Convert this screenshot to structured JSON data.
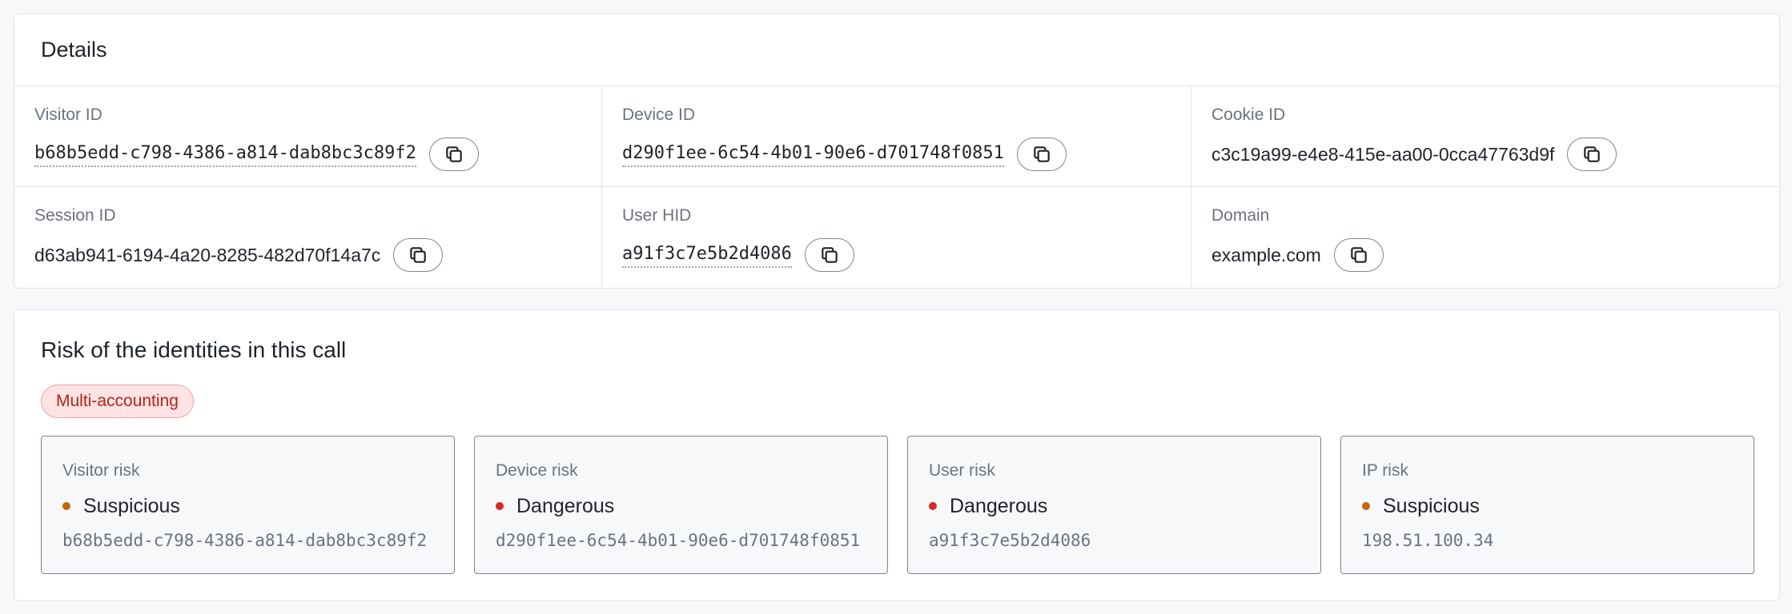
{
  "details": {
    "title": "Details",
    "fields": [
      {
        "label": "Visitor ID",
        "value": "b68b5edd-c798-4386-a814-dab8bc3c89f2",
        "mono": true
      },
      {
        "label": "Device ID",
        "value": "d290f1ee-6c54-4b01-90e6-d701748f0851",
        "mono": true
      },
      {
        "label": "Cookie ID",
        "value": "c3c19a99-e4e8-415e-aa00-0cca47763d9f",
        "mono": false
      },
      {
        "label": "Session ID",
        "value": "d63ab941-6194-4a20-8285-482d70f14a7c",
        "mono": false
      },
      {
        "label": "User HID",
        "value": "a91f3c7e5b2d4086",
        "mono": true
      },
      {
        "label": "Domain",
        "value": "example.com",
        "mono": false
      }
    ]
  },
  "risk": {
    "title": "Risk of the identities in this call",
    "badge": "Multi-accounting",
    "tiles": [
      {
        "label": "Visitor risk",
        "status": "Suspicious",
        "status_color": "#c2680a",
        "id": "b68b5edd-c798-4386-a814-dab8bc3c89f2"
      },
      {
        "label": "Device risk",
        "status": "Dangerous",
        "status_color": "#dc2626",
        "id": "d290f1ee-6c54-4b01-90e6-d701748f0851"
      },
      {
        "label": "User risk",
        "status": "Dangerous",
        "status_color": "#dc2626",
        "id": "a91f3c7e5b2d4086"
      },
      {
        "label": "IP risk",
        "status": "Suspicious",
        "status_color": "#c2680a",
        "id": "198.51.100.34"
      }
    ]
  },
  "icons": {
    "copy": "copy-icon"
  }
}
